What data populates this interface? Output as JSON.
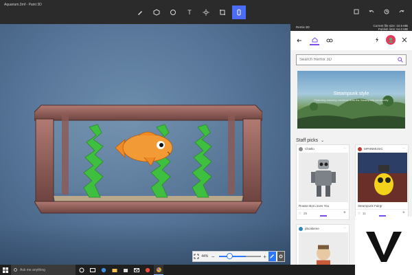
{
  "window": {
    "title": "Aquarium.3mf - Paint 3D"
  },
  "toolbar": {
    "tools": [
      {
        "name": "brushes-tool",
        "icon": "brush-icon"
      },
      {
        "name": "3d-shapes-tool",
        "icon": "cube-icon"
      },
      {
        "name": "2d-shapes-tool",
        "icon": "shapes-icon"
      },
      {
        "name": "text-tool",
        "icon": "text-icon",
        "glyph": "T"
      },
      {
        "name": "effects-tool",
        "icon": "sun-icon"
      },
      {
        "name": "canvas-tool",
        "icon": "crop-icon"
      },
      {
        "name": "remix-3d-tool",
        "icon": "remix-icon",
        "active": true
      }
    ],
    "right": [
      "paste-icon",
      "undo-icon",
      "history-icon",
      "redo-icon"
    ]
  },
  "panel": {
    "title": "Remix 3D",
    "file_size": "Current file size: 10.5 MB",
    "publish_limit": "Publish limit: 64.0 MB",
    "search_placeholder": "Search Remix 3D",
    "banner_title": "Steampunk style",
    "banner_subtitle": "Featuring amazing creations from the Steampunk community",
    "staff_picks": "Staff picks",
    "cards": [
      {
        "author": "Chiello",
        "caption": "Rowan Bot Loves You",
        "likes": "25",
        "author_color": "#8a8a8a"
      },
      {
        "author": "MPHNMUSIC",
        "caption": "Steampunk Fairgr",
        "likes": "11",
        "author_color": "#c0392b"
      },
      {
        "author": "pbcakeme",
        "caption": "",
        "likes": "",
        "author_color": "#2e86c1"
      }
    ]
  },
  "zoom": {
    "value": "44%",
    "fraction": 0.2
  },
  "taskbar": {
    "search_placeholder": "Ask me anything"
  },
  "watermark": {
    "letter": "V"
  },
  "colors": {
    "accent": "#4a6cf7",
    "panel_accent": "#7b4cf0",
    "fish": "#f08a24",
    "plant": "#3fbf3f"
  }
}
